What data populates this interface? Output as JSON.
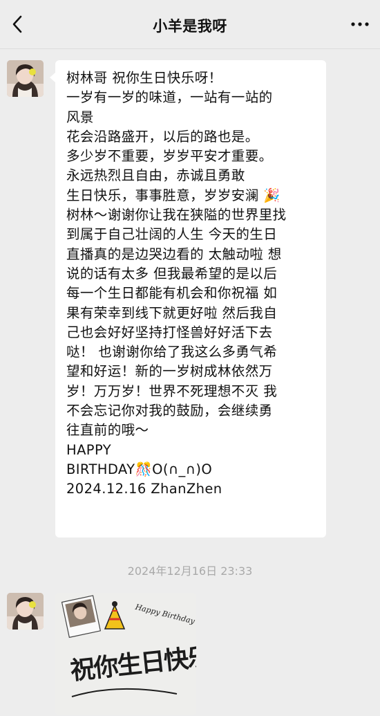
{
  "header": {
    "title": "小羊是我呀"
  },
  "message": {
    "lines": [
      "树林哥 祝你生日快乐呀！",
      "一岁有一岁的味道，一站有一站的",
      "风景",
      "花会沿路盛开，以后的路也是。",
      "多少岁不重要，岁岁平安才重要。",
      "永远热烈且自由，赤诚且勇敢",
      "生日快乐，事事胜意，岁岁安澜 🎉",
      "树林～谢谢你让我在狭隘的世界里找",
      "到属于自己壮阔的人生 今天的生日",
      "直播真的是边哭边看的 太触动啦  想",
      "说的话有太多 但我最希望的是以后",
      "每一个生日都能有机会和你祝福  如",
      "果有荣幸到线下就更好啦 然后我自",
      "己也会好好坚持打怪兽好好活下去",
      "哒！ 也谢谢你给了我这么多勇气希",
      "望和好运！新的一岁树成林依然万",
      "岁！万万岁！世界不死理想不灭 我",
      "不会忘记你对我的鼓励，会继续勇",
      "往直前的哦～",
      "HAPPY",
      "BIRTHDAY🎊O(∩_∩)O",
      "2024.12.16  ZhanZhen"
    ]
  },
  "timestamp": "2024年12月16日 23:33",
  "card": {
    "script_top": "Happy Birthday To you",
    "big_text": "祝你生日快乐"
  },
  "icons": {
    "back": "chevron-left-icon",
    "more": "ellipsis-icon"
  }
}
